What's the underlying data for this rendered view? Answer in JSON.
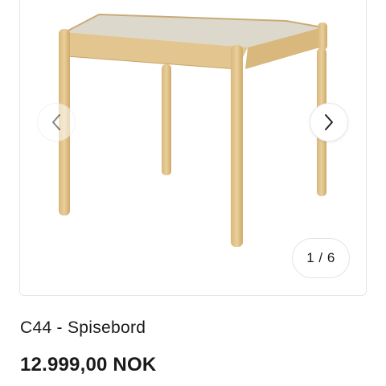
{
  "gallery": {
    "image_alt": "C44 - Spisebord",
    "counter": "1 / 6",
    "prev_icon": "chevron-left-icon",
    "next_icon": "chevron-right-icon"
  },
  "product": {
    "title": "C44 - Spisebord",
    "price": "12.999,00 NOK"
  }
}
